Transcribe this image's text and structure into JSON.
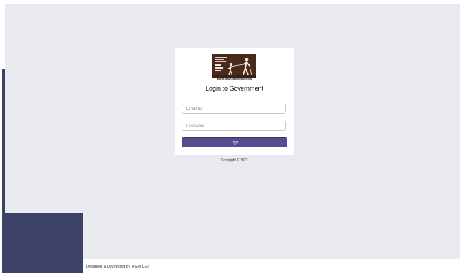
{
  "login_card": {
    "logo_caption": "MAHATMA GANDHI MISSION",
    "title": "Login to Government",
    "email_placeholder": "Email ID",
    "password_placeholder": "Password",
    "login_label": "Login"
  },
  "copyright": "Copyright © 2022",
  "footer": {
    "credit": "Designed & Developed By MGM CET"
  },
  "colors": {
    "page_background": "#e9ebf0",
    "sidebar_navy": "#3c4366",
    "button_purple": "#5a4b8e"
  },
  "icons": {
    "logo": "mgm-logo-figures"
  }
}
